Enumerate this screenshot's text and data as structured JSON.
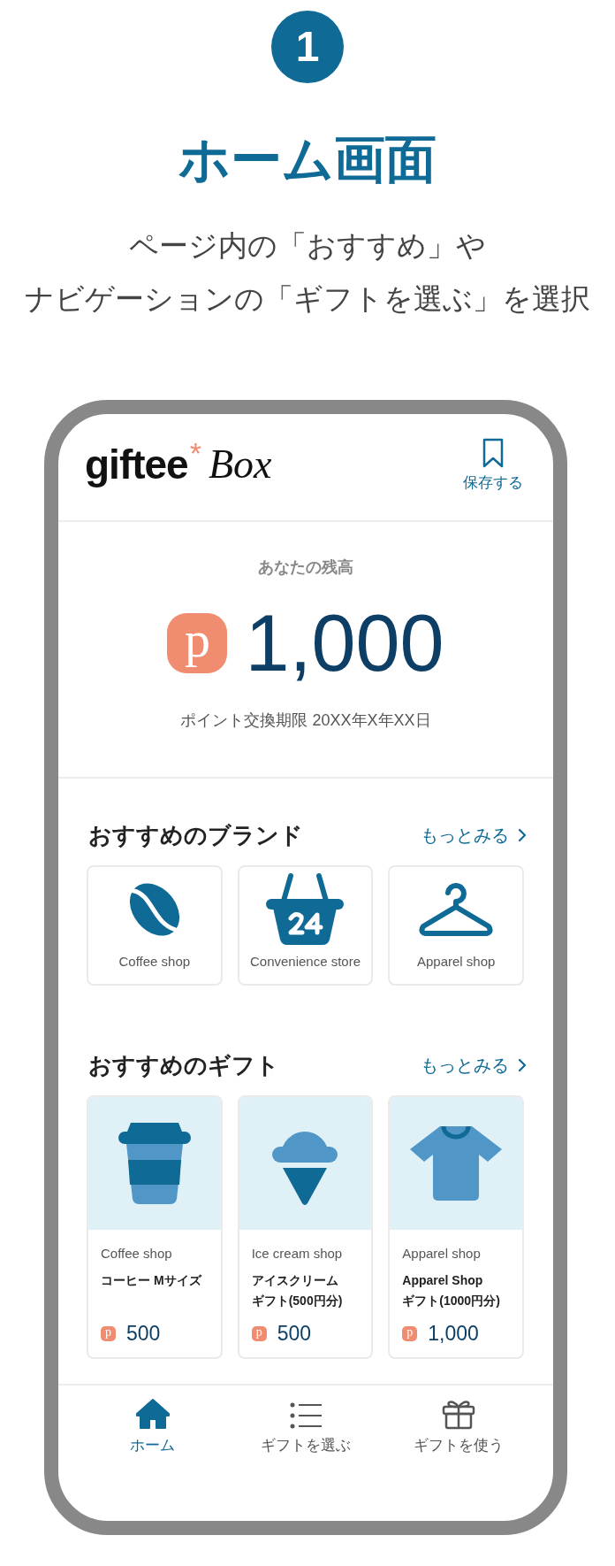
{
  "step": "1",
  "title": "ホーム画面",
  "subtitle_lines": [
    "ページ内の「おすすめ」や",
    "ナビゲーションの「ギフトを選ぶ」を選択"
  ],
  "header": {
    "logo": {
      "name": "giftee",
      "mark": "*",
      "suffix": "Box"
    },
    "save_label": "保存する"
  },
  "balance": {
    "label": "あなたの残高",
    "currency_mark": "p",
    "amount": "1,000",
    "expiry": "ポイント交換期限 20XX年X年XX日"
  },
  "brands": {
    "heading": "おすすめのブランド",
    "more": "もっとみる",
    "items": [
      {
        "kind": "coffee",
        "label": "Coffee shop"
      },
      {
        "kind": "basket",
        "label": "Convenience store"
      },
      {
        "kind": "hanger",
        "label": "Apparel shop"
      }
    ]
  },
  "gifts": {
    "heading": "おすすめのギフト",
    "more": "もっとみる",
    "items": [
      {
        "kind": "cup",
        "shop": "Coffee shop",
        "name": [
          "コーヒー Mサイズ"
        ],
        "currency_mark": "p",
        "price": "500"
      },
      {
        "kind": "icecream",
        "shop": "Ice cream shop",
        "name": [
          "アイスクリーム",
          "ギフト(500円分)"
        ],
        "currency_mark": "p",
        "price": "500"
      },
      {
        "kind": "shirt",
        "shop": "Apparel shop",
        "name": [
          "Apparel Shop",
          "ギフト(1000円分)"
        ],
        "currency_mark": "p",
        "price": "1,000"
      }
    ]
  },
  "nav": [
    {
      "kind": "home",
      "label": "ホーム",
      "selected": true
    },
    {
      "kind": "list",
      "label": "ギフトを選ぶ",
      "selected": false
    },
    {
      "kind": "gift",
      "label": "ギフトを使う",
      "selected": false
    }
  ]
}
